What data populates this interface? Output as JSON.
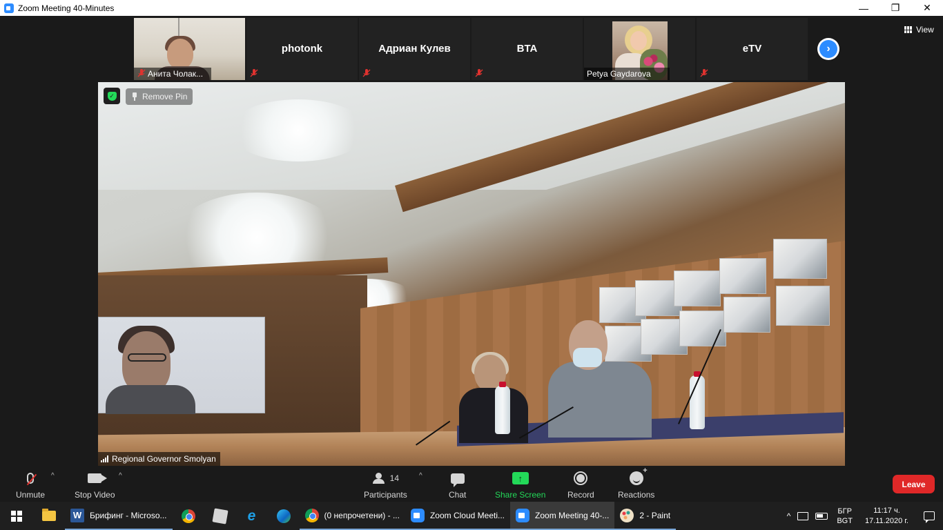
{
  "window": {
    "title": "Zoom Meeting 40-Minutes",
    "controls": {
      "minimize": "—",
      "restore": "❐",
      "close": "✕"
    }
  },
  "gallery": {
    "tiles": [
      {
        "name": "Анита Чолак...",
        "muted": true,
        "type": "video"
      },
      {
        "name": "photonk",
        "muted": true,
        "type": "name"
      },
      {
        "name": "Адриан Кулев",
        "muted": true,
        "type": "name"
      },
      {
        "name": "BTA",
        "muted": true,
        "type": "name"
      },
      {
        "name": "Petya Gaydarova",
        "muted": false,
        "type": "video"
      },
      {
        "name": "eTV",
        "muted": true,
        "type": "name"
      }
    ],
    "next_icon": "›",
    "view_label": "View"
  },
  "main_video": {
    "remove_pin_label": "Remove Pin",
    "speaker_name": "Regional Governor Smolyan",
    "shield_icon": "shield-check-icon"
  },
  "controls": {
    "unmute_label": "Unmute",
    "stop_video_label": "Stop Video",
    "participants_label": "Participants",
    "participants_count": "14",
    "chat_label": "Chat",
    "share_screen_label": "Share Screen",
    "record_label": "Record",
    "reactions_label": "Reactions",
    "leave_label": "Leave",
    "caret": "^",
    "share_arrow": "↑",
    "accent_green": "#23d959",
    "leave_red": "#e02828",
    "brand_blue": "#2d8cff"
  },
  "taskbar": {
    "apps": [
      {
        "label": "Брифинг - Microso...",
        "icon": "word-icon"
      },
      {
        "label": "(0 непрочетени) - ...",
        "icon": "chrome-icon"
      },
      {
        "label": "Zoom Cloud Meeti...",
        "icon": "zoom-icon"
      },
      {
        "label": "Zoom Meeting 40-...",
        "icon": "zoom-icon"
      },
      {
        "label": "2 - Paint",
        "icon": "paint-icon"
      }
    ],
    "ie_glyph": "e",
    "word_glyph": "W",
    "tray": {
      "chevron": "^",
      "lang_top": "БГР",
      "lang_bottom": "BGT",
      "time": "11:17 ч.",
      "date": "17.11.2020 г."
    }
  }
}
